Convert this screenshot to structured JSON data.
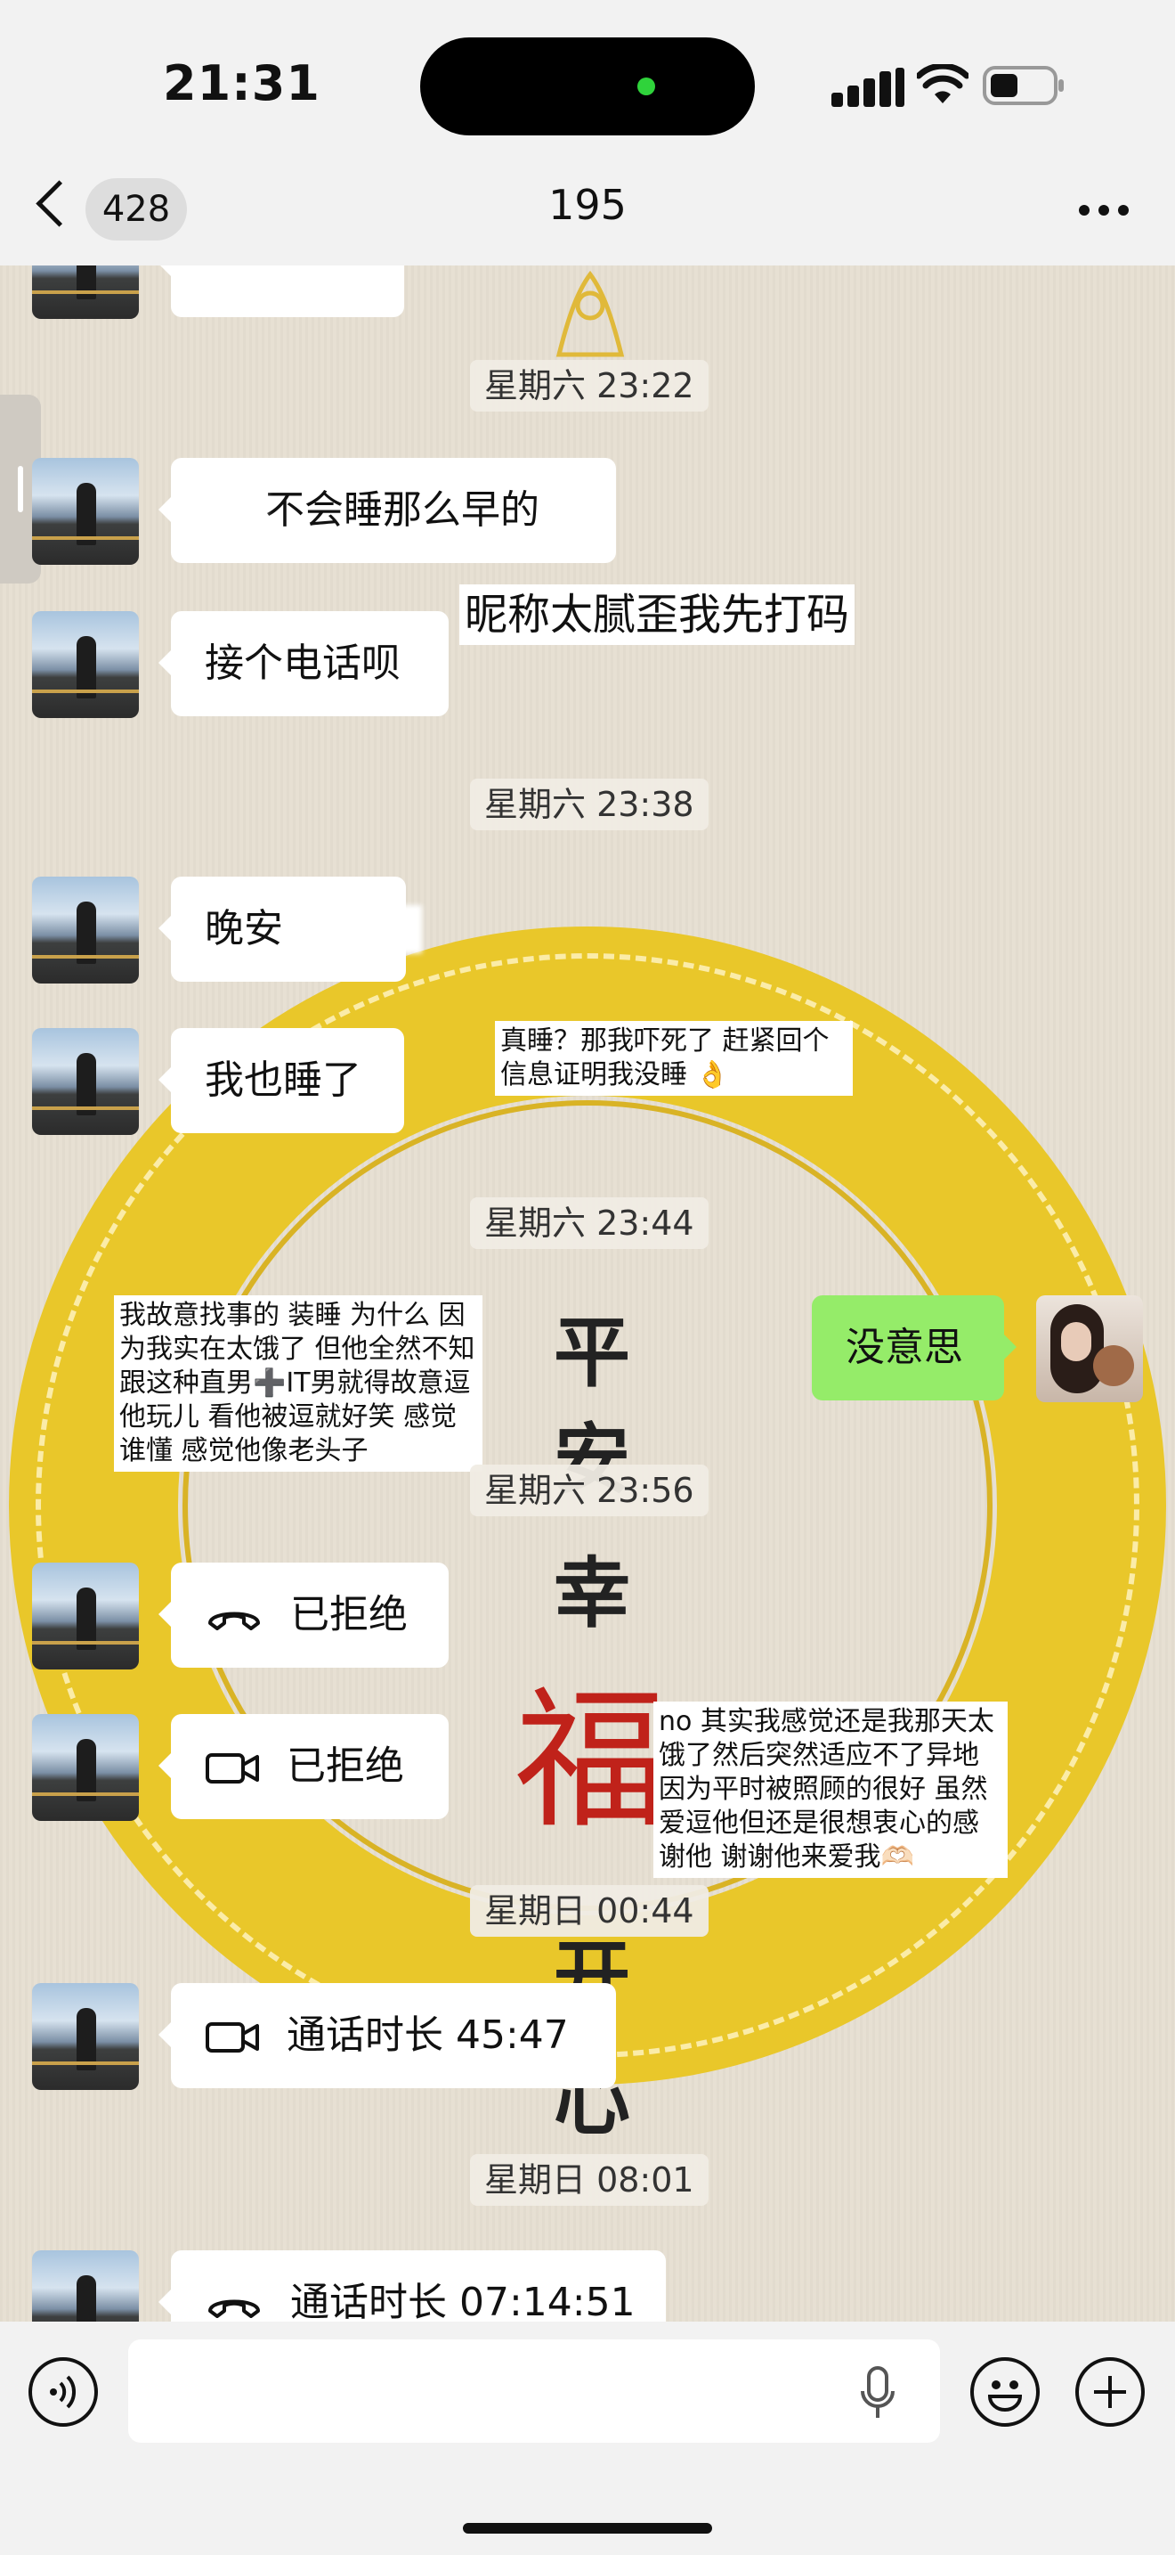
{
  "status_bar": {
    "time": "21:31"
  },
  "nav": {
    "unread_count": "428",
    "title": "195"
  },
  "messages": [
    {
      "type": "timestamp",
      "text": "星期六 23:22"
    },
    {
      "type": "text",
      "side": "left",
      "text": "不会睡那么早的"
    },
    {
      "type": "text",
      "side": "left",
      "text": "接个电话呗"
    },
    {
      "type": "timestamp",
      "text": "星期六 23:38"
    },
    {
      "type": "text",
      "side": "left",
      "text": "晚安"
    },
    {
      "type": "text",
      "side": "left",
      "text": "我也睡了"
    },
    {
      "type": "timestamp",
      "text": "星期六 23:44"
    },
    {
      "type": "text",
      "side": "right",
      "text": "没意思"
    },
    {
      "type": "timestamp",
      "text": "星期六 23:56"
    },
    {
      "type": "call",
      "side": "left",
      "icon": "phone-icon",
      "text": "已拒绝"
    },
    {
      "type": "call",
      "side": "left",
      "icon": "video-icon",
      "text": "已拒绝"
    },
    {
      "type": "timestamp",
      "text": "星期日 00:44"
    },
    {
      "type": "call",
      "side": "left",
      "icon": "video-icon",
      "text": "通话时长 45:47"
    },
    {
      "type": "timestamp",
      "text": "星期日 08:01"
    },
    {
      "type": "call",
      "side": "left",
      "icon": "phone-icon",
      "text": "通话时长 07:14:51"
    }
  ],
  "annotations": {
    "nickname_note": "昵称太腻歪我先打码",
    "really_asleep": "真睡？那我吓死了 赶紧回个信息证明我没睡 👌",
    "picking_fight": "我故意找事的 装睡 为什么 因为我实在太饿了 但他全然不知 跟这种直男➕IT男就得故意逗他玩儿 看他被逗就好笑 感觉谁懂 感觉他像老头子",
    "no_actually": "no 其实我感觉还是我那天太饿了然后突然适应不了异地 因为平时被照顾的很好 虽然爱逗他但还是很想衷心的感谢他 谢谢他来爱我🫶🏻"
  },
  "wallpaper": {
    "characters": [
      "平",
      "安",
      "幸",
      "福",
      "开",
      "心"
    ],
    "ring_color": "#e9c72a",
    "fu_color": "#c0221a"
  },
  "colors": {
    "sent_bubble": "#95ec69",
    "received_bubble": "#ffffff"
  }
}
